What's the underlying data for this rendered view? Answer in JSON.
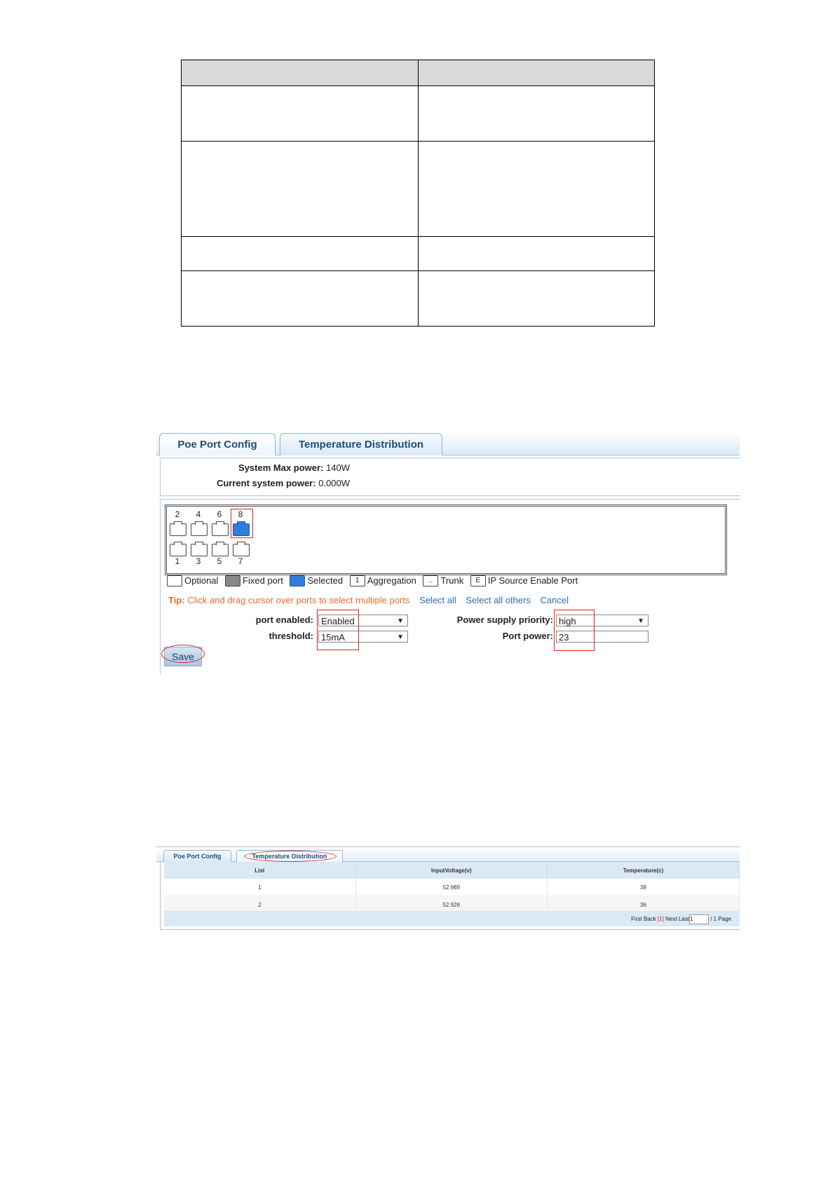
{
  "poe_config": {
    "tabs": [
      "Poe Port Config",
      "Temperature Distribution"
    ],
    "max_power_label": "System Max power:",
    "max_power_value": "140W",
    "current_power_label": "Current system power:",
    "current_power_value": "0.000W",
    "ports_top": [
      "2",
      "4",
      "6",
      "8"
    ],
    "ports_bottom": [
      "1",
      "3",
      "5",
      "7"
    ],
    "legend": {
      "optional": "Optional",
      "fixed": "Fixed port",
      "selected": "Selected",
      "aggregation_icon": "1",
      "aggregation": "Aggregation",
      "trunk_icon": "..",
      "trunk": "Trunk",
      "ip_source_icon": "E",
      "ip_source": "IP Source Enable Port"
    },
    "tip_label": "Tip:",
    "tip_text": "Click and drag cursor over ports to select multiple ports",
    "select_all": "Select all",
    "select_all_others": "Select all others",
    "cancel": "Cancel",
    "port_enabled_label": "port enabled:",
    "port_enabled_value": "Enabled",
    "threshold_label": "threshold:",
    "threshold_value": "15mA",
    "priority_label": "Power supply priority:",
    "priority_value": "high",
    "port_power_label": "Port power:",
    "port_power_value": "23",
    "save_label": "Save"
  },
  "temperature": {
    "tabs": [
      "Poe Port Config",
      "Temperature Distribution"
    ],
    "columns": [
      "List",
      "InputVoltage(v)",
      "Temperature(c)"
    ],
    "rows": [
      [
        "1",
        "52.989",
        "38"
      ],
      [
        "2",
        "52.926",
        "36"
      ]
    ],
    "pager": {
      "first": "First",
      "back": "Back",
      "current": "[1]",
      "next": "Next",
      "last": "Last",
      "input_value": "1",
      "total": "/ 1 Page"
    }
  }
}
